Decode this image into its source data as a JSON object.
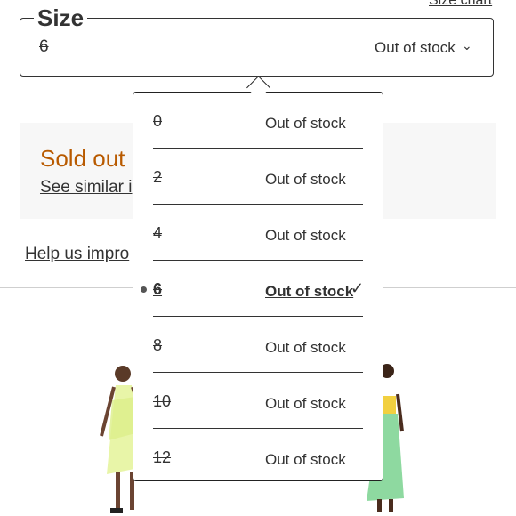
{
  "header": {
    "size_chart_label": "Size chart"
  },
  "size_field": {
    "legend": "Size",
    "value": "6",
    "status": "Out of stock",
    "chevron_icon": "chevron-down-icon"
  },
  "sold_out": {
    "title": "Sold out",
    "see_similar": "See similar i"
  },
  "help_link": "Help us impro",
  "dropdown": {
    "options": [
      {
        "size": "0",
        "status": "Out of stock"
      },
      {
        "size": "2",
        "status": "Out of stock"
      },
      {
        "size": "4",
        "status": "Out of stock"
      },
      {
        "size": "6",
        "status": "Out of stock",
        "selected": true
      },
      {
        "size": "8",
        "status": "Out of stock"
      },
      {
        "size": "10",
        "status": "Out of stock"
      },
      {
        "size": "12",
        "status": "Out of stock"
      }
    ],
    "check_icon": "check-icon"
  },
  "colors": {
    "accent": "#b85a00",
    "card_bg": "#f7f7f7",
    "text": "#333333"
  }
}
